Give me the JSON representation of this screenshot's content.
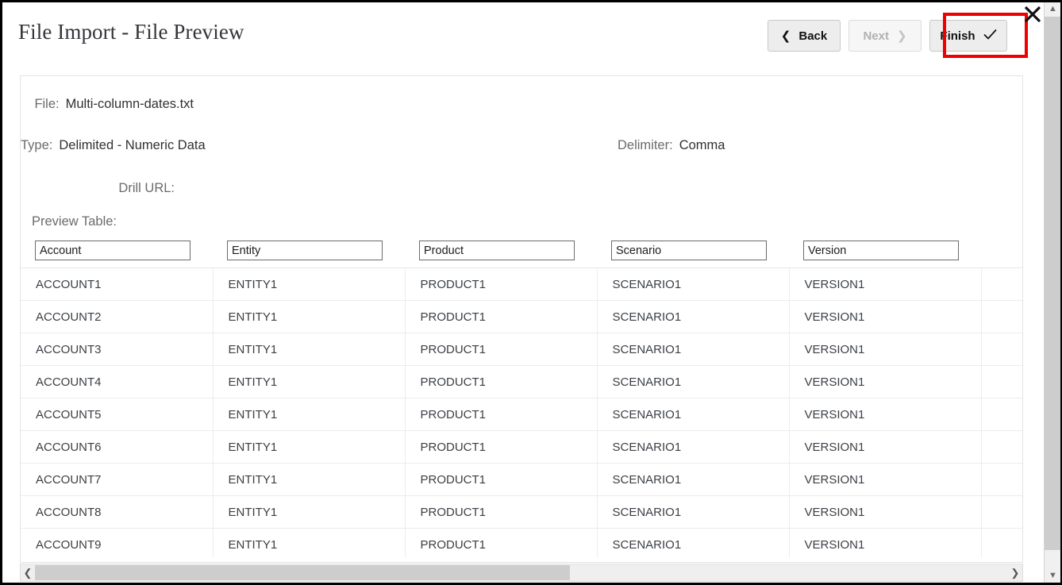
{
  "window": {
    "title": "File Import - File Preview",
    "close_icon": "close-icon"
  },
  "toolbar": {
    "back_label": "Back",
    "back_icon": "chevron-left-icon",
    "next_label": "Next",
    "next_icon": "chevron-right-icon",
    "next_disabled": true,
    "finish_label": "Finish",
    "finish_icon": "check-icon",
    "highlight_color": "#ee0000"
  },
  "meta": {
    "file_label": "File:",
    "file_value": "Multi-column-dates.txt",
    "type_label": "Type:",
    "type_value": "Delimited - Numeric Data",
    "delimiter_label": "Delimiter:",
    "delimiter_value": "Comma",
    "drill_url_label": "Drill URL:",
    "drill_url_value": ""
  },
  "preview": {
    "section_label": "Preview Table:",
    "column_headers": [
      "Account",
      "Entity",
      "Product",
      "Scenario",
      "Version",
      ""
    ],
    "rows": [
      [
        "ACCOUNT1",
        "ENTITY1",
        "PRODUCT1",
        "SCENARIO1",
        "VERSION1",
        ""
      ],
      [
        "ACCOUNT2",
        "ENTITY1",
        "PRODUCT1",
        "SCENARIO1",
        "VERSION1",
        ""
      ],
      [
        "ACCOUNT3",
        "ENTITY1",
        "PRODUCT1",
        "SCENARIO1",
        "VERSION1",
        ""
      ],
      [
        "ACCOUNT4",
        "ENTITY1",
        "PRODUCT1",
        "SCENARIO1",
        "VERSION1",
        ""
      ],
      [
        "ACCOUNT5",
        "ENTITY1",
        "PRODUCT1",
        "SCENARIO1",
        "VERSION1",
        ""
      ],
      [
        "ACCOUNT6",
        "ENTITY1",
        "PRODUCT1",
        "SCENARIO1",
        "VERSION1",
        ""
      ],
      [
        "ACCOUNT7",
        "ENTITY1",
        "PRODUCT1",
        "SCENARIO1",
        "VERSION1",
        ""
      ],
      [
        "ACCOUNT8",
        "ENTITY1",
        "PRODUCT1",
        "SCENARIO1",
        "VERSION1",
        ""
      ],
      [
        "ACCOUNT9",
        "ENTITY1",
        "PRODUCT1",
        "SCENARIO1",
        "VERSION1",
        ""
      ]
    ]
  },
  "scrollbars": {
    "horizontal_thumb_percent": 55,
    "horizontal_left_icon": "chevron-left-icon",
    "horizontal_right_icon": "chevron-right-icon",
    "vertical_up_icon": "chevron-up-icon",
    "vertical_down_icon": "chevron-down-icon"
  }
}
